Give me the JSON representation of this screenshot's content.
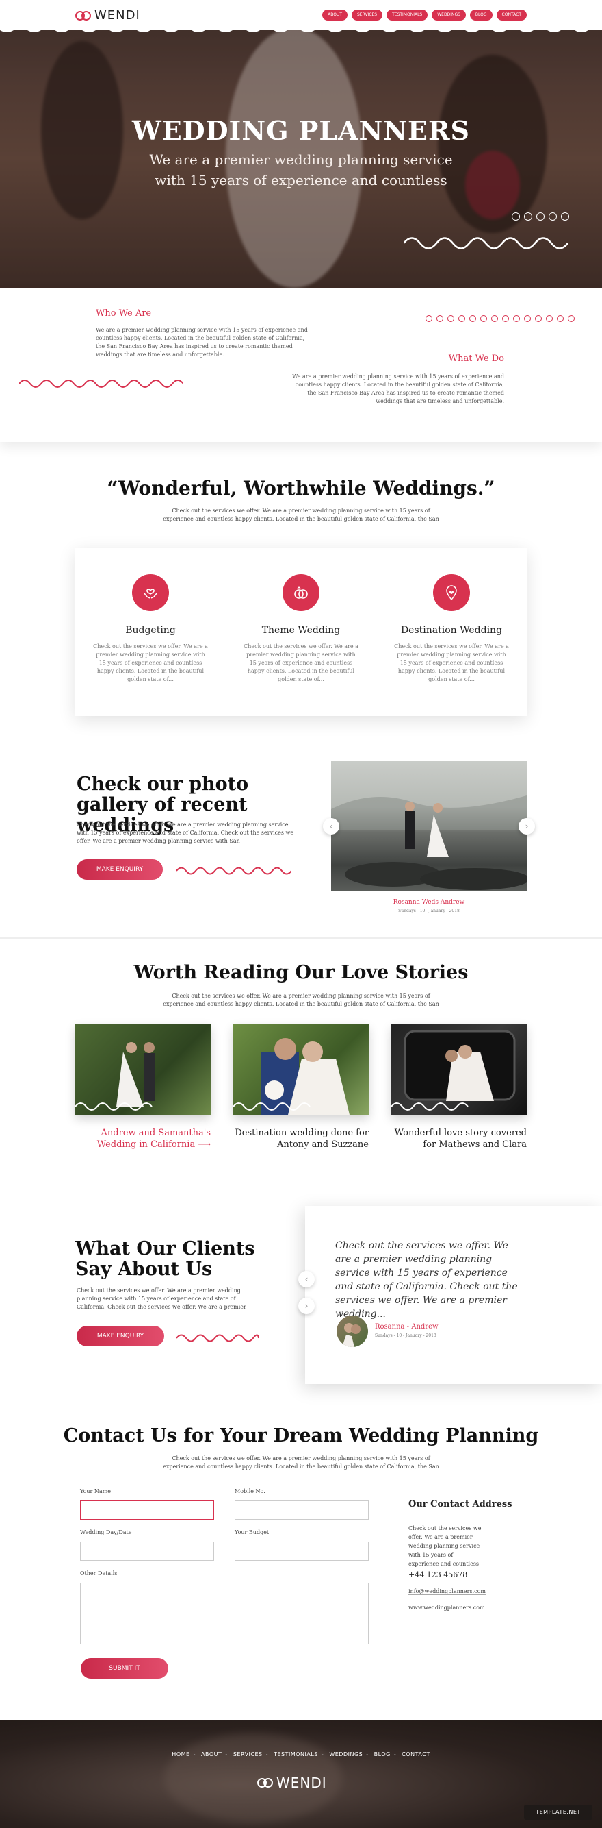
{
  "brand": {
    "logo_text": "WENDI",
    "accent": "#d8324f"
  },
  "nav": [
    {
      "label": "ABOUT"
    },
    {
      "label": "SERVICES"
    },
    {
      "label": "TESTIMONIALS"
    },
    {
      "label": "WEDDINGS"
    },
    {
      "label": "BLOG"
    },
    {
      "label": "CONTACT"
    }
  ],
  "hero": {
    "title": "WEDDING PLANNERS",
    "subtitle": "We are a premier wedding planning service with 15 years of experience and countless"
  },
  "who": {
    "title": "Who We Are",
    "text": "We are a premier wedding planning service with 15 years of experience and countless happy clients. Located in the beautiful golden state of California, the San Francisco Bay Area has inspired us to create romantic themed weddings that are timeless and unforgettable.",
    "what_title": "What We Do",
    "what_text": "We are a premier wedding planning service with 15 years of experience and countless happy clients. Located in the beautiful golden state of California, the San Francisco Bay Area has inspired us to create romantic themed weddings that are timeless and unforgettable."
  },
  "wonderful": {
    "title": "“Wonderful, Worthwhile Weddings.”",
    "subtitle": "Check out the services we offer. We are a premier wedding planning service with 15 years of experience and countless happy clients. Located in the beautiful golden state of California, the San"
  },
  "services": [
    {
      "icon": "hands-heart-icon",
      "title": "Budgeting",
      "text": "Check out the services we offer. We are a premier wedding planning service with 15 years of experience and countless happy clients. Located in the beautiful golden state of..."
    },
    {
      "icon": "rings-icon",
      "title": "Theme Wedding",
      "text": "Check out the services we offer. We are a premier wedding planning service with 15 years of experience and countless happy clients. Located in the beautiful golden state of..."
    },
    {
      "icon": "location-heart-icon",
      "title": "Destination Wedding",
      "text": "Check out the services we offer. We are a premier wedding planning service with 15 years of experience and countless happy clients. Located in the beautiful golden state of..."
    }
  ],
  "gallery": {
    "title": "Check our photo gallery of recent weddings",
    "text": "Check out the services we offer. We are a premier wedding planning service with 15 years of experience and state of California. Check out the services we offer. We are a premier wedding planning service with San",
    "button": "MAKE ENQUIRY",
    "caption": "Rosanna Weds Andrew",
    "date": "Sundays - 10 - January - 2018"
  },
  "love": {
    "title": "Worth Reading Our Love Stories",
    "subtitle": "Check out the services we offer. We are a premier wedding planning service with 15 years of experience and countless happy clients. Located in the beautiful golden state of California, the San",
    "stories": [
      {
        "caption": "Andrew and Samantha's Wedding in California",
        "arrow": "⟶"
      },
      {
        "caption": "Destination wedding done for Antony and Suzzane"
      },
      {
        "caption": "Wonderful love story covered for Mathews and Clara"
      }
    ]
  },
  "clients": {
    "title": "What Our Clients Say About Us",
    "text": "Check out the services we offer. We are a premier wedding planning service with 15 years of experience and state of California. Check out the services we offer. We are a premier",
    "button": "MAKE ENQUIRY",
    "quote": "Check out the services we offer. We are a premier wedding planning service with 15 years of experience and state of California. Check out the services we offer. We are a premier wedding...",
    "author": "Rosanna - Andrew",
    "date": "Sundays - 10 - January - 2018"
  },
  "contact": {
    "title": "Contact Us for Your Dream Wedding Planning",
    "subtitle": "Check out the services we offer. We are a premier wedding planning service with 15 years of experience and countless happy clients. Located in the beautiful golden state of California, the San",
    "labels": {
      "name": "Your Name",
      "mobile": "Mobile No.",
      "date": "Wedding Day/Date",
      "budget": "Your Budget",
      "details": "Other Details"
    },
    "submit": "SUBMIT IT",
    "address_title": "Our Contact Address",
    "address_text": "Check out the services we offer. We are a premier wedding planning service with 15 years of experience and countless",
    "phone": "+44 123 45678",
    "email": "info@weddingplanners.com",
    "web": "www.weddingplanners.com"
  },
  "footer": {
    "nav": [
      "HOME",
      "ABOUT",
      "SERVICES",
      "TESTIMONIALS",
      "WEDDINGS",
      "BLOG",
      "CONTACT"
    ],
    "logo_text": "WENDI",
    "badge": "TEMPLATE.NET"
  }
}
